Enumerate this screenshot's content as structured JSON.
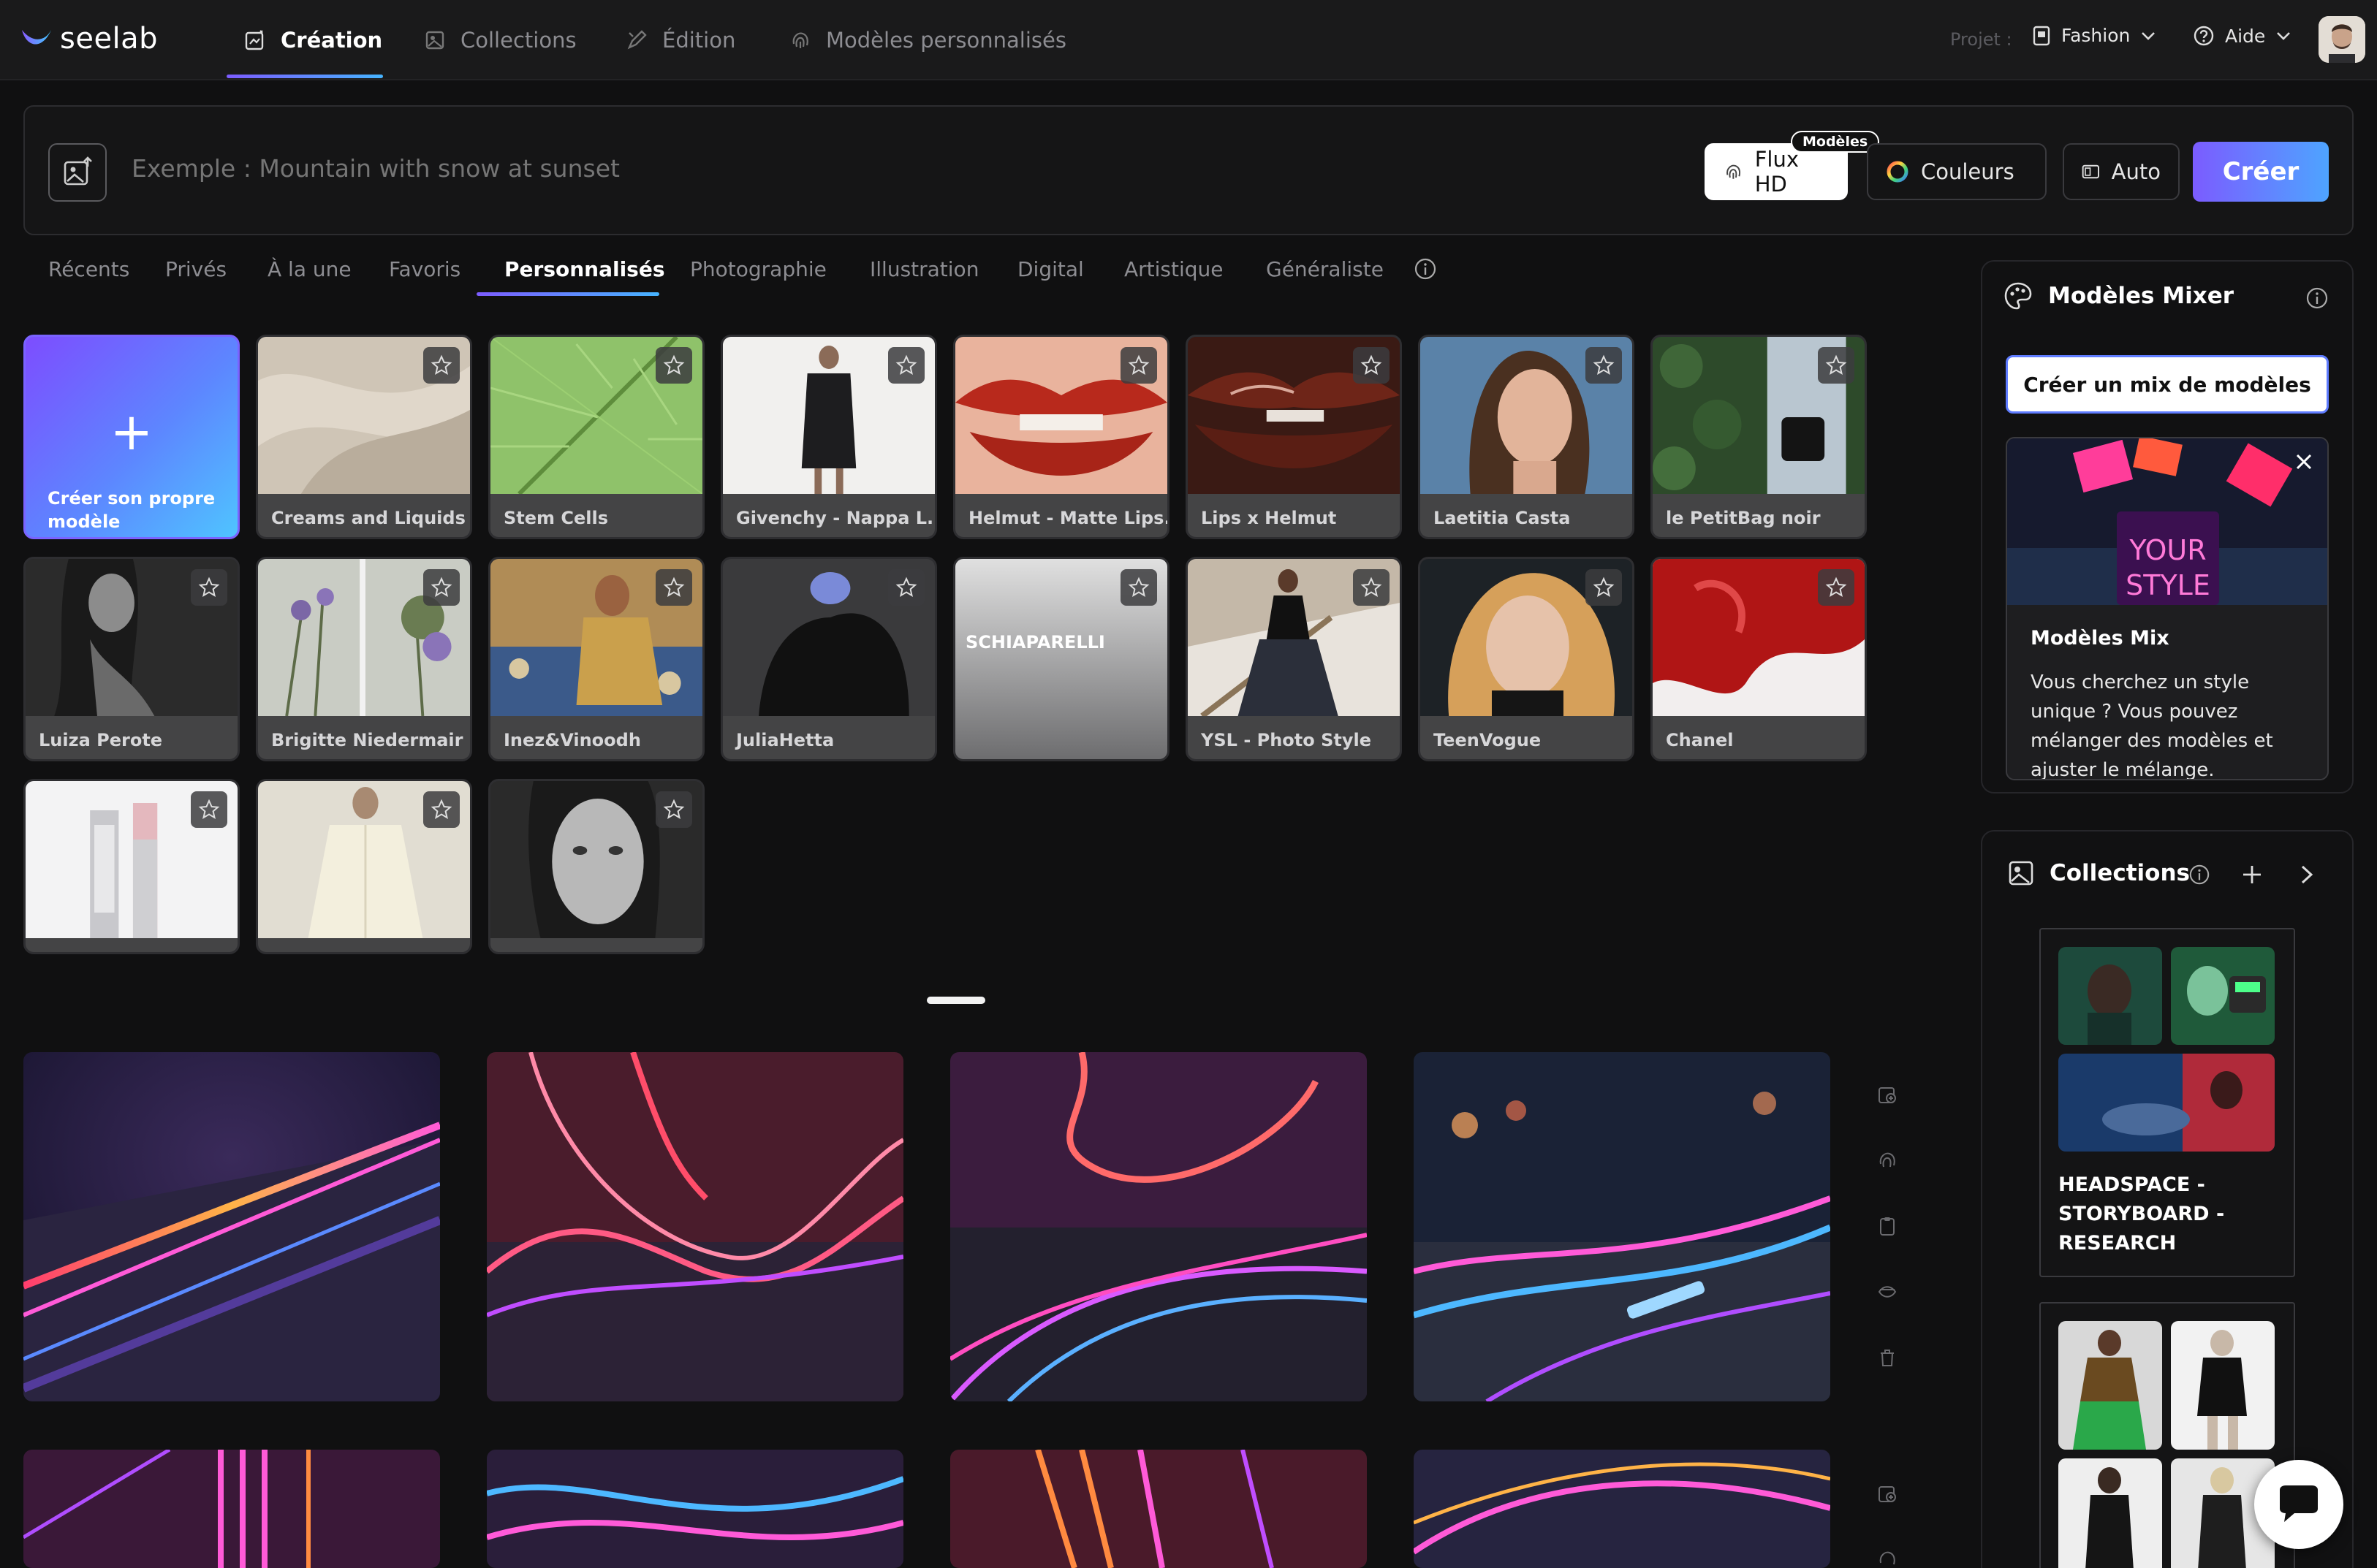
{
  "app": {
    "name": "seelab"
  },
  "nav": {
    "items": [
      {
        "label": "Création",
        "icon": "creation-icon"
      },
      {
        "label": "Collections",
        "icon": "collections-icon"
      },
      {
        "label": "Édition",
        "icon": "edit-icon"
      },
      {
        "label": "Modèles personnalisés",
        "icon": "fingerprint-icon"
      }
    ],
    "active": "Création"
  },
  "project": {
    "label": "Projet :",
    "value": "Fashion"
  },
  "help": {
    "label": "Aide"
  },
  "prompt": {
    "placeholder": "Exemple : Mountain with snow at sunset",
    "model_badge": "Modèles",
    "model_value": "Flux HD",
    "colors_label": "Couleurs",
    "format_label": "Auto",
    "create_label": "Créer"
  },
  "tabs": [
    "Récents",
    "Privés",
    "À la une",
    "Favoris",
    "Personnalisés",
    "Photographie",
    "Illustration",
    "Digital",
    "Artistique",
    "Généraliste"
  ],
  "active_tab": "Personnalisés",
  "models": {
    "new_label": "Créer son propre modèle",
    "row1": [
      "Creams and Liquids",
      "Stem Cells",
      "Givenchy - Nappa L...",
      "Helmut - Matte Lips...",
      "Lips x Helmut",
      "Laetitia Casta",
      "le PetitBag noir"
    ],
    "row2": [
      "Luiza Perote",
      "Brigitte Niedermair",
      "Inez&Vinoodh",
      "JuliaHetta",
      "SCHIAPARELLI",
      "YSL - Photo Style",
      "TeenVogue",
      "Chanel"
    ],
    "row3": [
      "",
      "",
      ""
    ]
  },
  "mixer": {
    "title": "Modèles Mixer",
    "button": "Créer un mix de modèles",
    "card_art_text": "YOUR STYLE",
    "card_title": "Modèles Mix",
    "card_text": "Vous cherchez un style unique ? Vous pouvez mélanger des modèles et ajuster le mélange."
  },
  "collections": {
    "title": "Collections",
    "items": [
      {
        "name": "HEADSPACE - STORYBOARD - RESEARCH"
      }
    ]
  },
  "colors": {
    "accent_start": "#7c5cff",
    "accent_end": "#46b4ff",
    "background": "#101011"
  }
}
